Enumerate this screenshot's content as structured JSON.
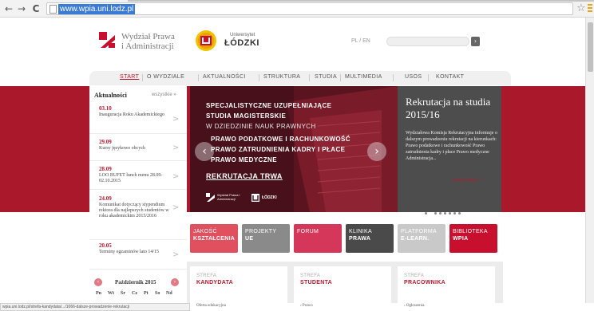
{
  "browser": {
    "url": "www.wpia.uni.lodz.pl",
    "back_glyph": "←",
    "forward_glyph": "→",
    "reload_glyph": "C",
    "star_glyph": "☆"
  },
  "header": {
    "faculty_line1": "Wydział Prawa",
    "faculty_line2": "i Administracji",
    "university_small": "Uniwersytet",
    "university_big": "ŁÓDZKI",
    "lang": "PL / EN",
    "search_btn": "›"
  },
  "nav": {
    "items": [
      "START",
      "O WYDZIALE",
      "AKTUALNOŚCI",
      "STRUKTURA",
      "STUDIA",
      "MULTIMEDIA",
      "USOS",
      "KONTAKT"
    ]
  },
  "news": {
    "title": "Aktualności",
    "all_link": "wszystkie »",
    "arrow": ">",
    "items": [
      {
        "date": "03.10",
        "text": "Inauguracja Roku Akademickiego"
      },
      {
        "date": "29.09",
        "text": "Kursy językowe obcych"
      },
      {
        "date": "28.09",
        "text": "LOO BUFET lunch menu 28.09-02.10.2015"
      },
      {
        "date": "24.09",
        "text": "Komunikat dotyczący stypendium rektora dla najlepszych studentów w roku akademickim 2015/2016"
      },
      {
        "date": "20.05",
        "text": "Terminy egzaminów lato 14/15"
      }
    ],
    "calendar_title": "Październik 2015",
    "cal_prev": "‹",
    "cal_next": "›",
    "cal_days": [
      "Pn",
      "Wt",
      "Śr",
      "Cz",
      "Pt",
      "So",
      "Nd"
    ]
  },
  "slider": {
    "line1": "SPECJALISTYCZNE UZUPEŁNIAJĄCE",
    "line2": "STUDIA MAGISTERSKIE",
    "line3": "W DZIEDZINIE NAUK PRAWNYCH",
    "line4": "PRAWO PODATKOWE I RACHUNKOWOŚĆ",
    "line5": "PRAWO ZATRUDNIENIA KADRY I PŁACE",
    "line6": "PRAWO MEDYCZNE",
    "cta": "REKRUTACJA TRWA",
    "prev": "‹",
    "next": "›",
    "logo_left": "Wydział Prawa i Administracji",
    "logo_right": "ŁÓDZKI"
  },
  "recruit": {
    "title": "Rekrutacja na studia 2015/16",
    "text": "Wydziałowa Komisja Rekrutacyjna informuje o dalszym prowadzeniu rekrutacji na kierunkach: Prawo podatkowe i rachunkowość Prawo zatrudnienia kadry i płace Prawo medyczne Administracja...",
    "more": "czytaj więcej >>"
  },
  "tiles": [
    {
      "l1": "JAKOŚĆ",
      "l2": "KSZTAŁCENIA",
      "bg": "#e0505f",
      "fg": "#ffffff"
    },
    {
      "l1": "PROJEKTY",
      "l2": "UE",
      "bg": "#8a8a8a",
      "fg": "#ffffff"
    },
    {
      "l1": "FORUM",
      "l2": "",
      "bg": "#d4375a",
      "fg": "#ffffff"
    },
    {
      "l1": "KLINIKA",
      "l2": "PRAWA",
      "bg": "#4a4a4a",
      "fg": "#ffffff"
    },
    {
      "l1": "PLATFORMA",
      "l2": "E-LEARN.",
      "bg": "#c9c9c9",
      "fg": "#ffffff"
    },
    {
      "l1": "BIBLIOTEKA",
      "l2": "WPIA",
      "bg": "#c8102e",
      "fg": "#ffffff"
    }
  ],
  "zones": [
    {
      "l1": "STREFA",
      "l2": "KANDYDATA",
      "item": "Oferta edukacyjna"
    },
    {
      "l1": "STREFA",
      "l2": "STUDENTA",
      "item": "› Prawo"
    },
    {
      "l1": "STREFA",
      "l2": "PRACOWNIKA",
      "item": "› Ogłoszenia"
    }
  ],
  "status": "wpia.uni.lodz.pl/strefa-kandydata/.../1066-dalsze-prowadzenie-rekrutacji",
  "colors": {
    "brand_red": "#a9192b",
    "accent": "#c0162b"
  }
}
